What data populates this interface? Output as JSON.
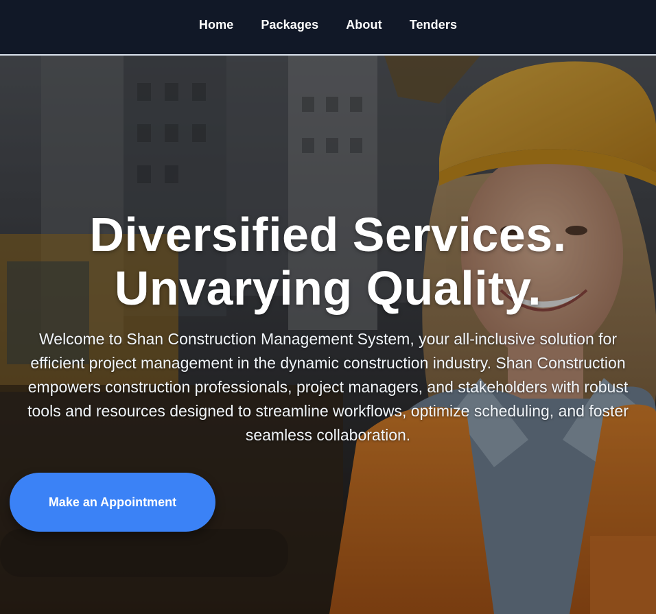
{
  "nav": {
    "items": [
      "Home",
      "Packages",
      "About",
      "Tenders"
    ]
  },
  "hero": {
    "title_line1": "Diversified Services.",
    "title_line2": "Unvarying Quality.",
    "description": "Welcome to Shan Construction Management System, your all-inclusive solution for efficient project management in the dynamic construction industry. Shan Construction empowers construction professionals, project managers, and stakeholders with robust tools and resources designed to streamline workflows, optimize scheduling, and foster seamless collaboration.",
    "cta_label": "Make an Appointment"
  },
  "colors": {
    "nav_bg": "#111827",
    "accent": "#3b82f6",
    "helmet": "#e7a52e",
    "vest": "#e8842c"
  }
}
